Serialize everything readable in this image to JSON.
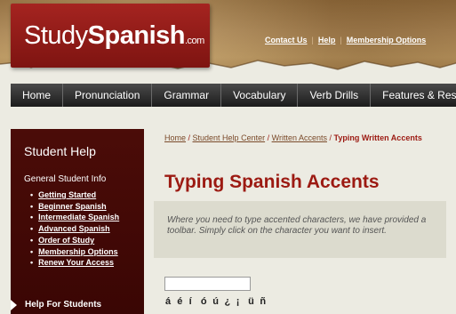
{
  "logo": {
    "study": "Study",
    "spanish": "Spanish",
    "com": ".com"
  },
  "toplinks": [
    "Contact Us",
    "Help",
    "Membership Options"
  ],
  "nav": [
    "Home",
    "Pronunciation",
    "Grammar",
    "Vocabulary",
    "Verb Drills",
    "Features & Res"
  ],
  "sidebar": {
    "title": "Student Help",
    "subtitle": "General Student Info",
    "items": [
      "Getting Started",
      "Beginner Spanish",
      "Intermediate Spanish",
      "Advanced Spanish",
      "Order of Study",
      "Membership Options",
      "Renew Your Access"
    ],
    "help_label": "Help For Students"
  },
  "breadcrumb": {
    "home": "Home",
    "sep": " / ",
    "center": "Student Help Center",
    "accents": "Written Accents",
    "current": "Typing Written Accents"
  },
  "main": {
    "title": "Typing Spanish Accents",
    "info": "Where you need to type accented characters, we have provided a toolbar. Simply click on the character you want to insert.",
    "input_value": "",
    "accents": [
      "á",
      "é",
      "í",
      "ó",
      "ú",
      "¿",
      "¡",
      "ü",
      "ñ"
    ]
  }
}
